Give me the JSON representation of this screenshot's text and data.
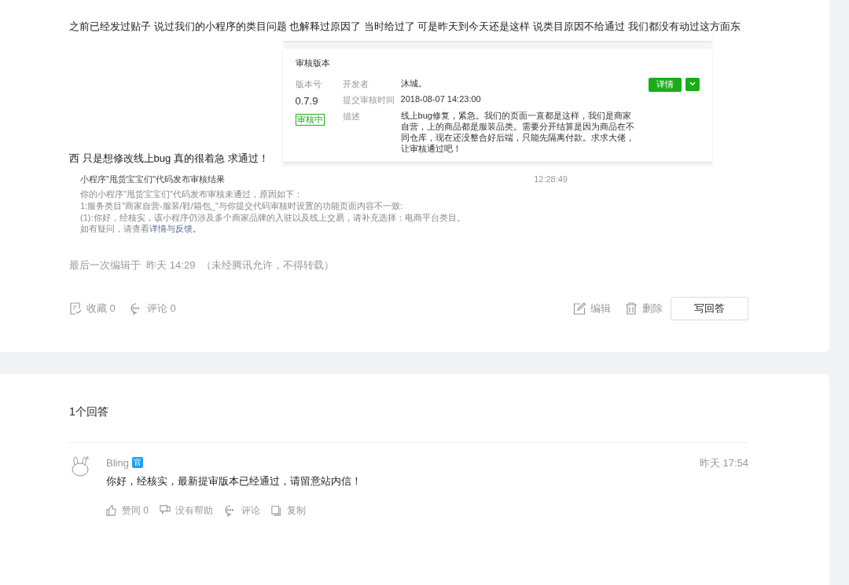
{
  "post": {
    "text_before": "之前已经发过贴子 说过我们的小程序的类目问题 也解释过原因了 当时给过了 可是昨天到今天还是这样 说类目原因不给通过 我们都没有动过这方面东",
    "text_after": "西 只是想修改线上bug 真的很着急 求通过！",
    "review_card": {
      "title": "审核版本",
      "version_label": "版本号",
      "version": "0.7.9",
      "status": "审核中",
      "fields": [
        {
          "label": "开发者",
          "value": "沐城。"
        },
        {
          "label": "提交审核时间",
          "value": "2018-08-07 14:23:00"
        },
        {
          "label": "描述",
          "value": "线上bug修复，紧急。我们的页面一直都是这样，我们是商家自营，上的商品都是服装品类。需要分开结算是因为商品在不同仓库，现在还没整合好后端，只能先隔离付款。求求大佬，让审核通过吧！"
        }
      ],
      "detail_button": "详情"
    },
    "notice": {
      "title": "小程序\"甩货宝宝们\"代码发布审核结果",
      "time": "12:28:49",
      "lines": [
        "你的小程序\"甩货宝宝们\"代码发布审核未通过，原因如下：",
        "1:服务类目\"商家自营-服装/鞋/箱包_\"与你提交代码审核时设置的功能页面内容不一致:",
        "(1):你好，经核实，该小程序仍涉及多个商家品牌的入驻以及线上交易，请补充选择：电商平台类目。"
      ],
      "help_text": "如有疑问，请查看",
      "help_link": "详情与反馈。"
    },
    "edited": "最后一次编辑于  昨天 14:29  （未经腾讯允许，不得转载）",
    "actions": [
      {
        "kind": "favorite",
        "label": "收藏 0"
      },
      {
        "kind": "comment",
        "label": "评论 0"
      }
    ],
    "owner_actions": [
      {
        "kind": "edit",
        "label": "编辑"
      },
      {
        "kind": "delete",
        "label": "删除"
      }
    ],
    "answer_button": "写回答"
  },
  "answers": {
    "count": "1个回答",
    "items": [
      {
        "author": "Bling",
        "badge": "官",
        "time": "昨天 17:54",
        "text": "你好，经核实，最新提审版本已经通过，请留意站内信！",
        "actions": [
          {
            "kind": "like",
            "label": "赞同 0"
          },
          {
            "kind": "unhelpful",
            "label": "没有帮助"
          },
          {
            "kind": "comment",
            "label": "评论"
          },
          {
            "kind": "copy",
            "label": "复制"
          }
        ]
      }
    ]
  }
}
